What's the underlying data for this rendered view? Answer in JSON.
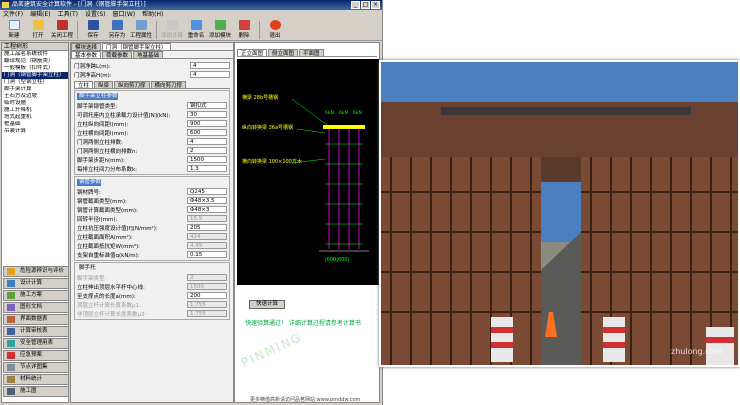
{
  "app": {
    "title": "品茗建筑安全计算软件 - [门洞（钢管脚手架立柱）]",
    "menu": [
      "文件(F)",
      "编辑(E)",
      "工具(T)",
      "设置(S)",
      "窗口(W)",
      "帮助(H)"
    ],
    "toolbar": [
      "新建",
      "打开",
      "关闭工程",
      "保存",
      "另存为",
      "工程属性",
      "添加计算",
      "重命名",
      "添加模块",
      "删除",
      "退出"
    ]
  },
  "left_panel": {
    "title": "工程树形",
    "tree": [
      "施工品茗系统软件",
      "翻译规范（钢筋类）",
      "一般模板（扣件式）",
      "门洞（钢管脚手架立柱）",
      "门洞（型钢立柱）",
      "脚手架计算",
      "土石方及边坡",
      "临时设施",
      "施工升降机",
      "塔式起重机",
      "桩基础",
      "吊装计算"
    ],
    "functions": [
      "危险源辨识与评价",
      "设计计算",
      "施工方案",
      "图形文档",
      "界面数据表",
      "计算审核表",
      "安全管理用表",
      "应急预案",
      "节点详图集",
      "材料统计",
      "施工图"
    ]
  },
  "form": {
    "top_tabs": [
      "模块选择",
      "门洞（钢管脚手架立柱）"
    ],
    "sub_tabs": [
      "基本参数",
      "荷载参数",
      "地基基础"
    ],
    "inner_tabs": [
      "立柱",
      "纵梁",
      "纵向剪刀撑",
      "横向剪刀撑"
    ],
    "fields": [
      {
        "label": "门洞净跨L(m):",
        "value": "4"
      },
      {
        "label": "门洞净高H(m):",
        "value": "4"
      }
    ],
    "group1": {
      "title": "脚手架立柱参数",
      "rows": [
        {
          "label": "脚手架钢管类型:",
          "value": "钢扣式"
        },
        {
          "label": "可调托座内立柱承载力设计值[N](kN):",
          "value": "30"
        },
        {
          "label": "立柱纵向间距l(mm):",
          "value": "900"
        },
        {
          "label": "立柱横向间距l(mm):",
          "value": "600"
        },
        {
          "label": "门洞两侧立柱排数:",
          "value": "4"
        },
        {
          "label": "门洞两侧立柱横向排数n:",
          "value": "2"
        },
        {
          "label": "脚手架步距h(mm):",
          "value": "1500"
        },
        {
          "label": "每排立柱间力分布系数k:",
          "value": "1.3"
        }
      ]
    },
    "group2": {
      "title": "钢管参数",
      "rows": [
        {
          "label": "钢材牌号:",
          "value": "Q245"
        },
        {
          "label": "钢管截面类型(mm):",
          "value": "Φ48×3.5"
        },
        {
          "label": "钢管计算截面类型(mm):",
          "value": "Φ48×3"
        },
        {
          "label": "回转半径i(mm):",
          "value": "15.9"
        },
        {
          "label": "立柱抗压强度设计值[f](N/mm²):",
          "value": "205"
        },
        {
          "label": "立柱截面面积A(mm²):",
          "value": "424"
        },
        {
          "label": "立柱截面抵抗矩W(mm³):",
          "value": "4.49"
        },
        {
          "label": "支架自重标准值q(kN/m):",
          "value": "0.15"
        }
      ]
    },
    "group3": {
      "title": "脚手托",
      "rows": [
        {
          "label": "脚手架类型:",
          "value": "2"
        },
        {
          "label": "立柱伸出顶层水平杆中心线:",
          "value": "1500"
        },
        {
          "label": "至支撑点的长度a(mm):",
          "value": "200"
        },
        {
          "label": "顶层立杆计算长度系数μ1:",
          "value": "1.755"
        },
        {
          "label": "非顶层立杆计算长度系数μ2:",
          "value": "1.755"
        }
      ]
    }
  },
  "graph": {
    "tabs": [
      "正立面图",
      "侧立面图",
      "平面图"
    ],
    "labels": [
      "横梁 28b号槽钢",
      "纵向转换梁 36a号槽钢",
      "横向转换梁 100×100方木"
    ],
    "dim": "|600|600|",
    "top_dims": [
      "6kN",
      "6kN",
      "6kN"
    ],
    "button": "快速计算",
    "message": "快速验算通过！ 详细计算过程请参考计算书",
    "watermark": "PINMING"
  },
  "photo": {
    "watermark": "zhulong.com"
  },
  "footer": "更多精值高新请访问品茗网站:www.pmddw.com",
  "colors": {
    "titlebar": "#0a246a",
    "group_title": "#4a7bc8",
    "message": "#00aa44",
    "cad_green": "#00ff00",
    "cad_magenta": "#ff00ff",
    "cad_yellow": "#ffff00"
  }
}
